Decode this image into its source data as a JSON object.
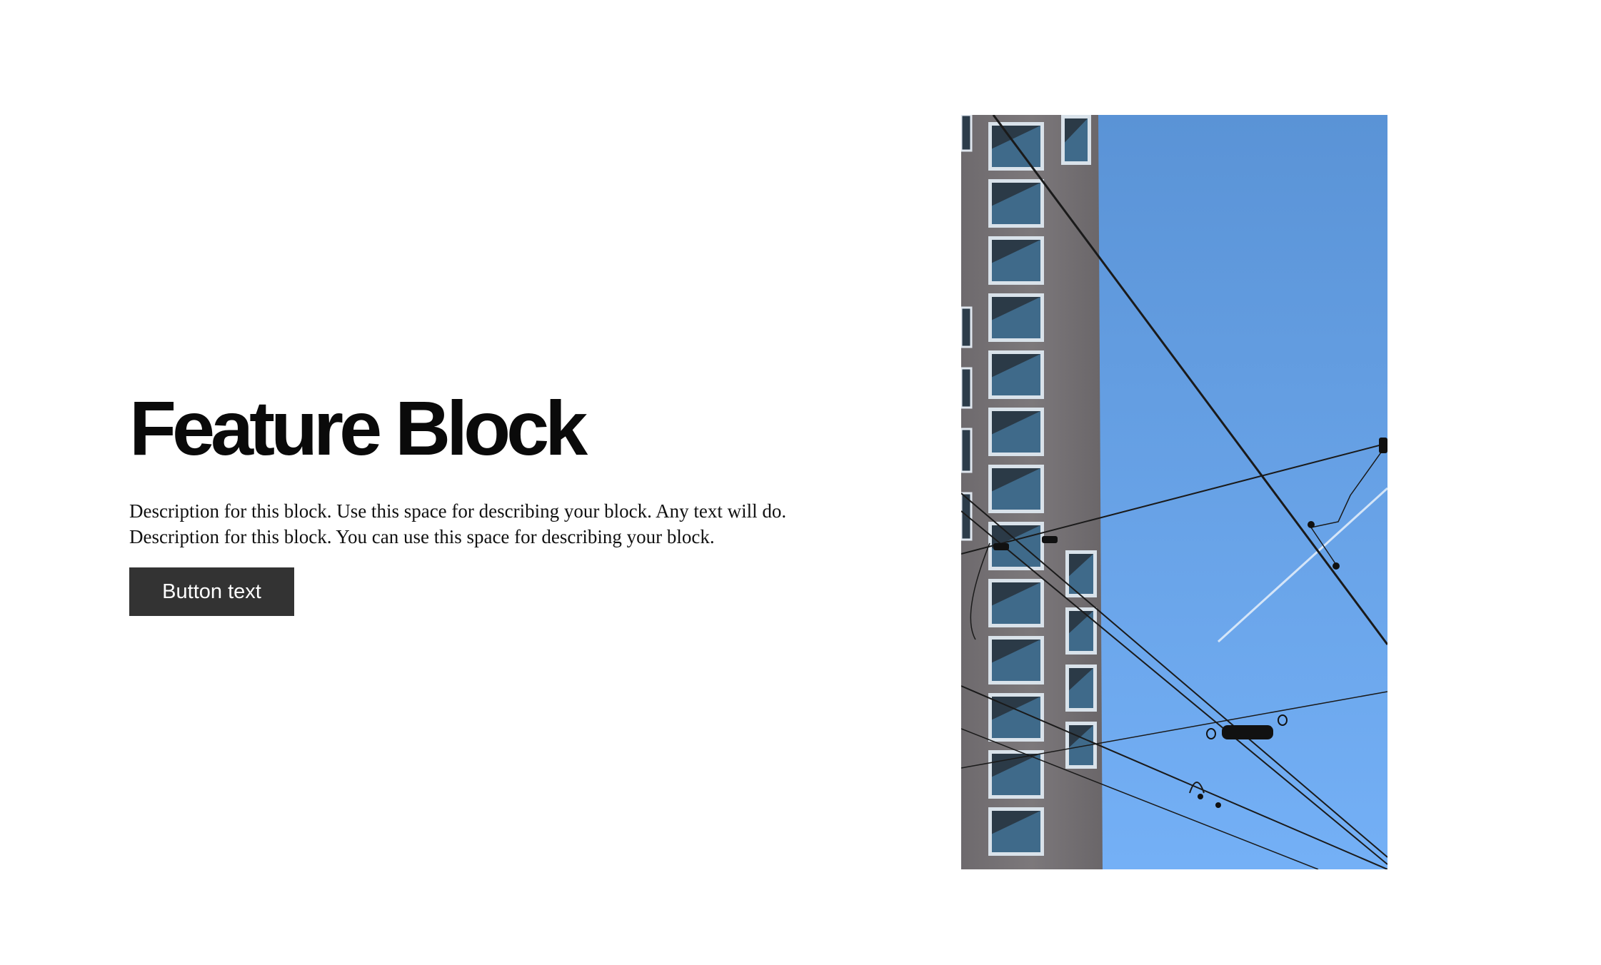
{
  "feature": {
    "title": "Feature Block",
    "description": "Description for this block. Use this space for describing your block. Any text will do. Description for this block. You can use this space for describing your block.",
    "button_label": "Button text"
  },
  "image": {
    "subject": "building-facade-with-overhead-tram-wires",
    "colors": {
      "sky_top": "#5a93d6",
      "sky_bottom": "#74b0f6",
      "building": "#767275",
      "window": "#3f6a8a"
    }
  }
}
